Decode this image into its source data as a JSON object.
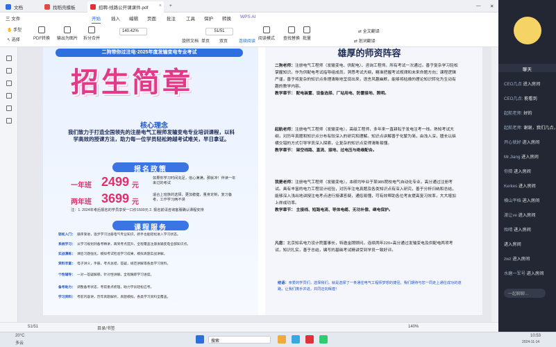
{
  "tabs": [
    {
      "label": "文档",
      "color": "#2e6fe0"
    },
    {
      "label": "找稻壳模板",
      "color": "#e24a4a"
    },
    {
      "label": "招聘-线路公开课课件.pdf",
      "color": "#e0303a"
    }
  ],
  "menu": [
    "三 文件",
    "开始",
    "插入",
    "编辑",
    "页面",
    "批注",
    "工具",
    "保护",
    "转换",
    "WPS AI"
  ],
  "toolbar": {
    "hand": "手型",
    "select": "选择",
    "pdf_edit": "PDF转换",
    "export_img": "输出为图片",
    "split_merge": "拆分合并",
    "zoom": "140.42%",
    "page_input": "51/51",
    "single": "单页",
    "double": "双页",
    "continuous": "连续阅读",
    "read": "阅读模式",
    "rotate": "旋转文档",
    "find_replace": "查找替换",
    "batch": "批量",
    "full_translate": "全文翻译",
    "translate": "划词翻译"
  },
  "doc": {
    "banner": "二狗带你过注电·2025年度发输变电专业考试",
    "main_title": "招生简章",
    "core_title": "核心理念",
    "core_text": "我们致力于打造全国领先的注册电气工程师发输变电专业培训课程，以科学高效的授课方法，助力每一位学员轻松跨越考试难关，早日拿证。",
    "policy_title": "报名政策",
    "prices": [
      {
        "plan": "一年班",
        "price": "2499",
        "unit": "元",
        "desc": "如果你学习时间充足，信心满满，那就冲！伴读一年来过的考试"
      },
      {
        "plan": "两年班",
        "price": "3699",
        "unit": "元",
        "desc": "适合上班族的选择，更加稳健，量身定制，复习备考，工作学习两不误"
      }
    ],
    "note": "注：1. 2024年考后报名的学员享受一口价1500元 2. 报名前请咨询客服确认课程安排",
    "service_title": "课程服务",
    "services": [
      {
        "k": "轻松入门：",
        "v": "循序渐进，逐步学习注册电气专业知识，新手也能轻松进入学习状态。"
      },
      {
        "k": "系统学习：",
        "v": "从学习规划到备考精讲，再到考点提升，全程覆盖注册发输变电全部知识点。"
      },
      {
        "k": "实战演练：",
        "v": "课后习题强化，模拟考试检验学习成果，模拟真题实战讲解。"
      },
      {
        "k": "资料丰富：",
        "v": "电子讲义，手册，考点总结，答疑，规范讲解等各类学习资料。"
      },
      {
        "k": "个性辅导：",
        "v": "一对一答疑解惑，针对性讲解，全程跟踪学习进度。"
      },
      {
        "k": "备考助力：",
        "v": "调整备考状态，考前重点梳理，助力学员轻松应考。"
      },
      {
        "k": "学习资料：",
        "v": "考前内容讲，历年真题解析，真题模拟，各类学习资料全覆盖。"
      }
    ],
    "teacher_title": "雄厚的师资阵容",
    "teachers": [
      {
        "name": "二狗老师：",
        "text": "注册电气工程师（发输变电、供配电）、咨询工程师。所有考试一次通过。善于复杂学习轻松掌握知识。作为供配电考试指导组成员，洞悉考试大纲，精准把握考试规律和未来命题方向；课程逻辑严谨，善于将复杂的知识点条理清晰地呈现出来，语言风趣幽默，能够将枯燥的理论知识转化为生动有趣的教学内容。",
        "subjects": "教学章节： 配电装置、设备选择、厂站用电、防雷接地、照明。"
      },
      {
        "name": "起航老师：",
        "text": "注册电气工程师（发输变电），高级工程师，多年来一直耕耘于发电注考一线。熟知考试大纲，对历年真题和知识点分布有较深入的研究和理解。知识点讲解善于化繁为简，由浅入深，擅长以纵横交错的方式引导学员深入探索，让复杂的知识点变得清晰易懂。",
        "subjects": "教学章节： 架空线路、直流、接地、过电压与绝缘配合。"
      },
      {
        "name": "我是老师：",
        "text": "注册电气工程师（发输变电），本硕均毕业于某985院校电气自动化专业，高分通过注册考试。具有丰富的电力工程设计经验，对历年注电真题及各类知识点有深入研究，善于分析归纳和总结，能够深入浅出地讲授注电考点进行授课答疑，通俗易懂，可有效帮助各位考友提高复习效率，大大增加上岸成功率。",
        "subjects": "教学章节： 主接线、短路电流、导体电缆、无功补偿、继电保护。"
      }
    ],
    "intro_label": "凡您：",
    "intro_text": "北京知名电力设计院董事长，特邀金牌顾问，连续两年220+高分通过发输变电及供配电两项考试，知识扎实，善于总结，编写的基础考试精讲受到学员一致好评。",
    "closing_label": "结语：",
    "closing_text": "亲爱的学员们，选择我们，就是选择了一条通往电气工程师梦想的捷径。我们期待与您一同走上通往成功的道路，让我们携手并进，共同迈向辉煌！"
  },
  "status": {
    "page": "51/51",
    "outline": "目录/书签",
    "zoom": "140%"
  },
  "chat": {
    "title": "聊天",
    "messages": [
      {
        "name": "CEO几点",
        "text": "进入房间"
      },
      {
        "name": "CEO几点:",
        "text": "能看到"
      },
      {
        "name": "起航老师:",
        "text": "好的"
      },
      {
        "name": "起航老师:",
        "text": "谢谢，我们几点，你好"
      },
      {
        "name": "开心就好",
        "text": "进入房间"
      },
      {
        "name": "Mr.Jiang",
        "text": "进入房间"
      },
      {
        "name": "你猜",
        "text": "进入房间"
      },
      {
        "name": "Kerkes",
        "text": "进入房间"
      },
      {
        "name": "横山平档",
        "text": "进入房间"
      },
      {
        "name": "渡让ve",
        "text": "进入房间"
      },
      {
        "name": "殆晴",
        "text": "进入房间"
      },
      {
        "name": "",
        "text": "进入房间"
      },
      {
        "name": "zwz",
        "text": "进入房间"
      },
      {
        "name": "水磨一军号",
        "text": "进入房间"
      }
    ],
    "input_placeholder": "一起聊聊..."
  },
  "taskbar": {
    "temp": "20°C",
    "weather": "多云",
    "search": "搜索",
    "time": "10:53",
    "date": "2024-11-14"
  }
}
